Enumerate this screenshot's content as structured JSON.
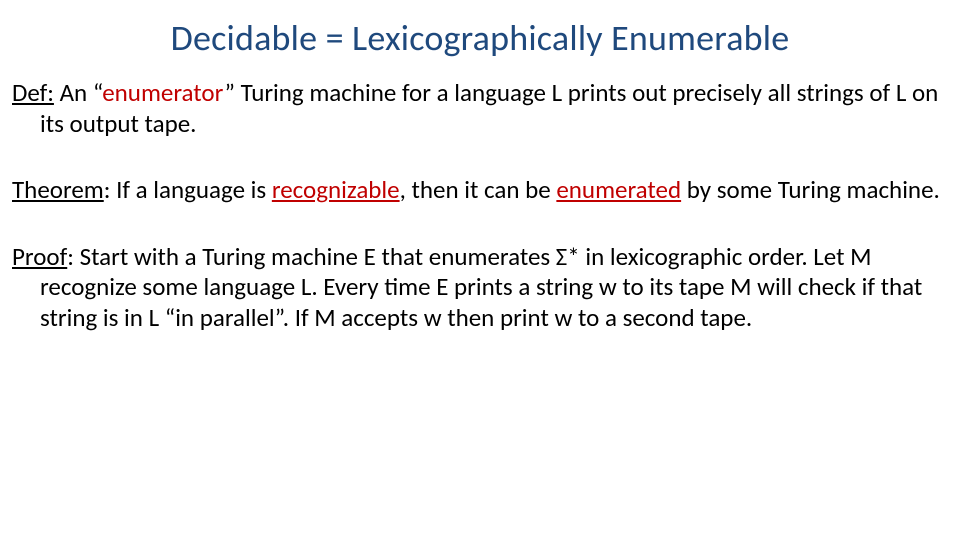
{
  "slide": {
    "title": "Decidable = Lexicographically Enumerable",
    "def": {
      "label": "Def:",
      "pre": "   An “",
      "enumerator_word": "enumerator",
      "post": "” Turing machine for a language L prints out precisely all strings of L on its output tape."
    },
    "theorem": {
      "label": "Theorem",
      "sep": ": ",
      "pre": "If a language is ",
      "recognizable_word": "recognizable",
      "mid": ", then it can be ",
      "enumerated_word": "enumerated",
      "post": " by some Turing machine."
    },
    "proof": {
      "label": "Proof",
      "sep": ":  ",
      "text": "Start with a Turing machine E that enumerates Σ* in lexicographic order. Let M recognize some language L. Every time E prints a string w to its tape M will check if that string is in L “in parallel”. If M accepts w then print w to a second tape."
    }
  }
}
